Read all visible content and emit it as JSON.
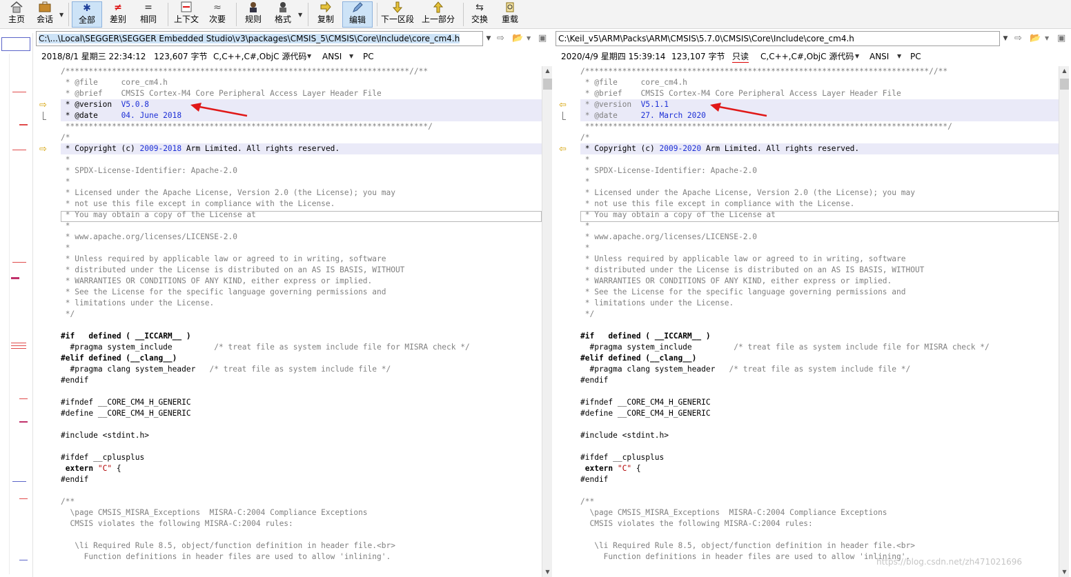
{
  "toolbar": {
    "items": [
      {
        "label": "主页",
        "icon": "home-icon"
      },
      {
        "label": "会话",
        "icon": "briefcase-icon"
      },
      {
        "label": "全部",
        "icon": "asterisk-icon"
      },
      {
        "label": "差别",
        "icon": "not-equal-icon"
      },
      {
        "label": "相同",
        "icon": "equal-icon"
      },
      {
        "label": "上下文",
        "icon": "context-icon"
      },
      {
        "label": "次要",
        "icon": "approx-icon"
      },
      {
        "label": "规则",
        "icon": "rules-icon"
      },
      {
        "label": "格式",
        "icon": "format-icon"
      },
      {
        "label": "复制",
        "icon": "copy-arrow-icon"
      },
      {
        "label": "编辑",
        "icon": "edit-icon"
      },
      {
        "label": "下一区段",
        "icon": "down-arrow-icon"
      },
      {
        "label": "上一部分",
        "icon": "up-arrow-icon"
      },
      {
        "label": "交换",
        "icon": "swap-icon"
      },
      {
        "label": "重载",
        "icon": "reload-icon"
      }
    ]
  },
  "left": {
    "path": "C:\\...\\Local\\SEGGER\\SEGGER Embedded Studio\\v3\\packages\\CMSIS_5\\CMSIS\\Core\\Include\\core_cm4.h",
    "datetime": "2018/8/1 星期三 22:34:12",
    "size": "123,607 字节",
    "format": "C,C++,C#,ObjC 源代码",
    "encoding": "ANSI",
    "lineend": "PC",
    "version": "V5.0.8",
    "date_text": "04. June 2018",
    "copyright": "2009-2018"
  },
  "right": {
    "path": "C:\\Keil_v5\\ARM\\Packs\\ARM\\CMSIS\\5.7.0\\CMSIS\\Core\\Include\\core_cm4.h",
    "datetime": "2020/4/9 星期四 15:39:14",
    "size": "123,107 字节",
    "readonly": "只读",
    "format": "C,C++,C#,ObjC 源代码",
    "encoding": "ANSI",
    "lineend": "PC",
    "version": "V5.1.1",
    "date_text": "27. March 2020",
    "copyright": "2009-2020"
  },
  "code": {
    "header_top_left": "/**************************************************************************//**",
    "header_top_right": "/**************************************************************************//**",
    "file_line": " * @file     core_cm4.h",
    "brief_line": " * @brief    CMSIS Cortex-M4 Core Peripheral Access Layer Header File",
    "version_prefix": " * @version  ",
    "date_prefix": " * @date     ",
    "header_end": " ******************************************************************************/",
    "comment_open": "/*",
    "copyright_prefix": " * Copyright (c) ",
    "copyright_suffix": " Arm Limited. All rights reserved.",
    "star": " *",
    "spdx": " * SPDX-License-Identifier: Apache-2.0",
    "lic1": " * Licensed under the Apache License, Version 2.0 (the License); you may",
    "lic2": " * not use this file except in compliance with the License.",
    "lic3": " * You may obtain a copy of the License at",
    "lic4": " * www.apache.org/licenses/LICENSE-2.0",
    "lic5": " * Unless required by applicable law or agreed to in writing, software",
    "lic6": " * distributed under the License is distributed on an AS IS BASIS, WITHOUT",
    "lic7": " * WARRANTIES OR CONDITIONS OF ANY KIND, either express or implied.",
    "lic8": " * See the License for the specific language governing permissions and",
    "lic9": " * limitations under the License.",
    "comment_close": " */",
    "if_kw": "#if",
    "if_rest": "   defined ( __ICCARM__ )",
    "pragma1": "  #pragma system_include",
    "pragma1_cm": "         /* treat file as system include file for MISRA check */",
    "elif_kw": "#elif",
    "elif_rest": " defined (__clang__)",
    "pragma2": "  #pragma clang system_header",
    "pragma2_cm": "   /* treat file as system include file */",
    "endif": "#endif",
    "ifndef": "#ifndef __CORE_CM4_H_GENERIC",
    "define": "#define __CORE_CM4_H_GENERIC",
    "include": "#include <stdint.h>",
    "ifdef": "#ifdef __cplusplus",
    "extern_kw": " extern",
    "extern_str": "\"C\"",
    "extern_brace": " {",
    "doc_open": "/**",
    "page_line": "  \\page CMSIS_MISRA_Exceptions  MISRA-C:2004 Compliance Exceptions",
    "violates_line": "  CMSIS violates the following MISRA-C:2004 rules:",
    "li_line": "   \\li Required Rule 8.5, object/function definition in header file.<br>",
    "func_line": "     Function definitions in header files are used to allow 'inlining'."
  },
  "watermark": "https://blog.csdn.net/zh471021696",
  "colors": {
    "diff_blue": "#1c2fd6",
    "highlight": "#eaeaf8",
    "arrow_red": "#e01818",
    "marker_yellow": "#d4a000"
  }
}
